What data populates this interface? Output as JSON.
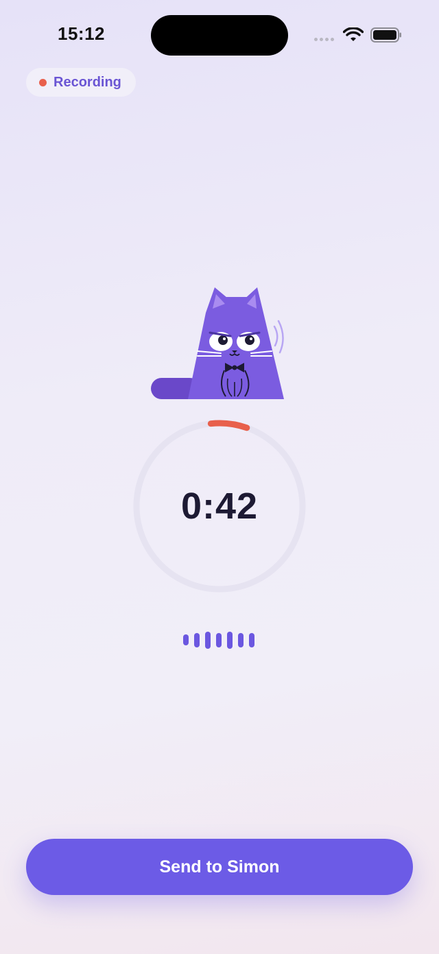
{
  "status_bar": {
    "time": "15:12"
  },
  "recording_badge": {
    "label": "Recording",
    "dot_color": "#e8604c"
  },
  "timer": {
    "elapsed": "0:42",
    "progress_fraction": 0.07,
    "progress_color": "#e8604c"
  },
  "waveform": {
    "bar_levels": [
      0.6,
      0.8,
      0.95,
      0.8,
      0.95,
      0.8,
      0.8
    ]
  },
  "send_button": {
    "label": "Send to Simon"
  },
  "colors": {
    "accent": "#6c5be6",
    "cat_body": "#7b5ce0",
    "text_primary": "#1d1a33"
  }
}
